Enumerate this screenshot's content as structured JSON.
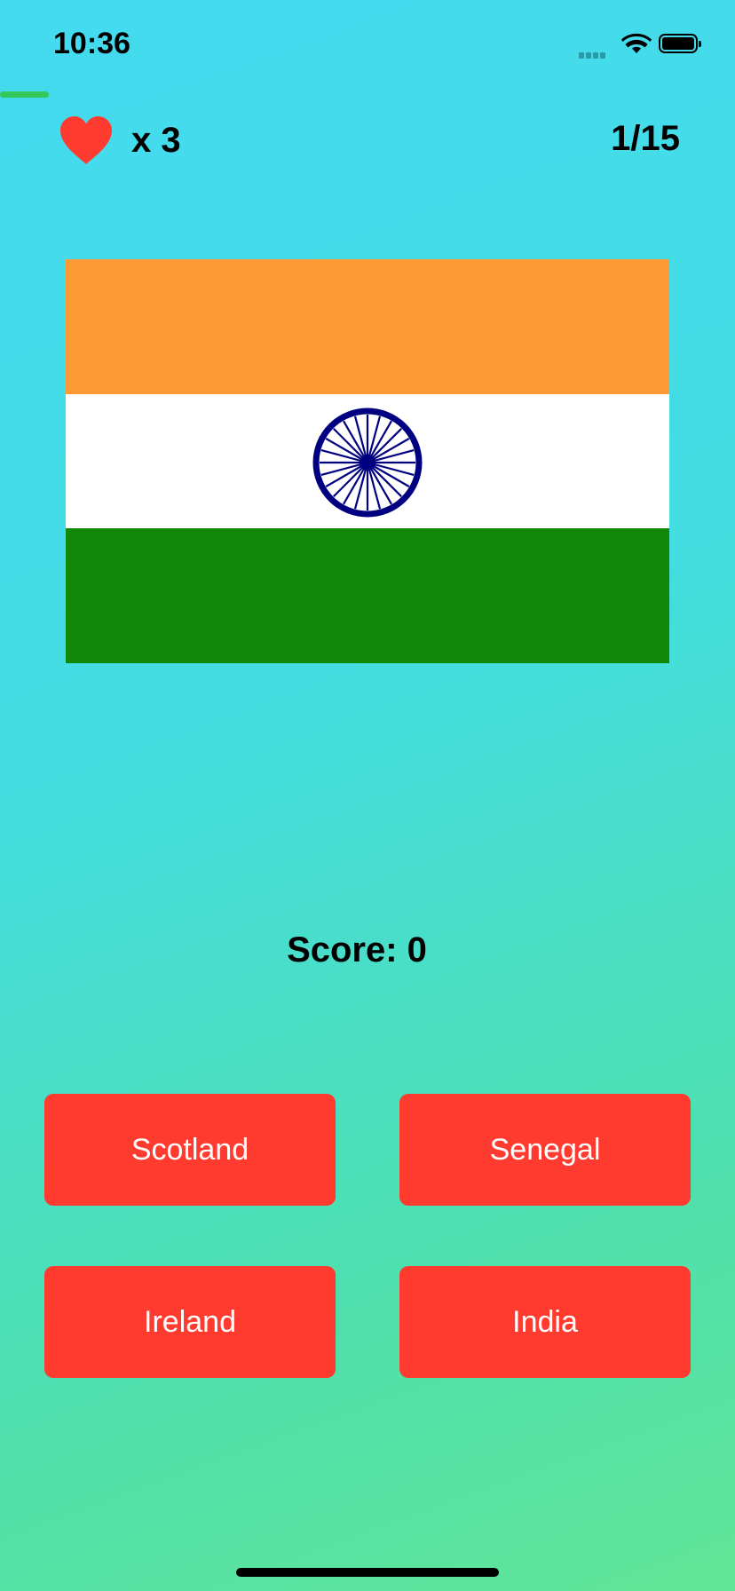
{
  "status_bar": {
    "time": "10:36"
  },
  "quiz": {
    "lives_label": "x 3",
    "progress_fraction": 0.067,
    "question_counter": "1/15",
    "score_label": "Score: 0"
  },
  "flag": {
    "country_shown": "India",
    "colors": {
      "saffron": "#ff9933",
      "white": "#ffffff",
      "green": "#138808",
      "chakra": "#000080"
    }
  },
  "answers": [
    {
      "label": "Scotland"
    },
    {
      "label": "Senegal"
    },
    {
      "label": "Ireland"
    },
    {
      "label": "India"
    }
  ],
  "colors": {
    "answer_button": "#ff3b30",
    "heart": "#ff3b30",
    "progress": "#34c759"
  },
  "icons": {
    "lives": "heart-icon",
    "signal": "cellular-signal-icon",
    "wifi": "wifi-icon",
    "battery": "battery-icon"
  }
}
